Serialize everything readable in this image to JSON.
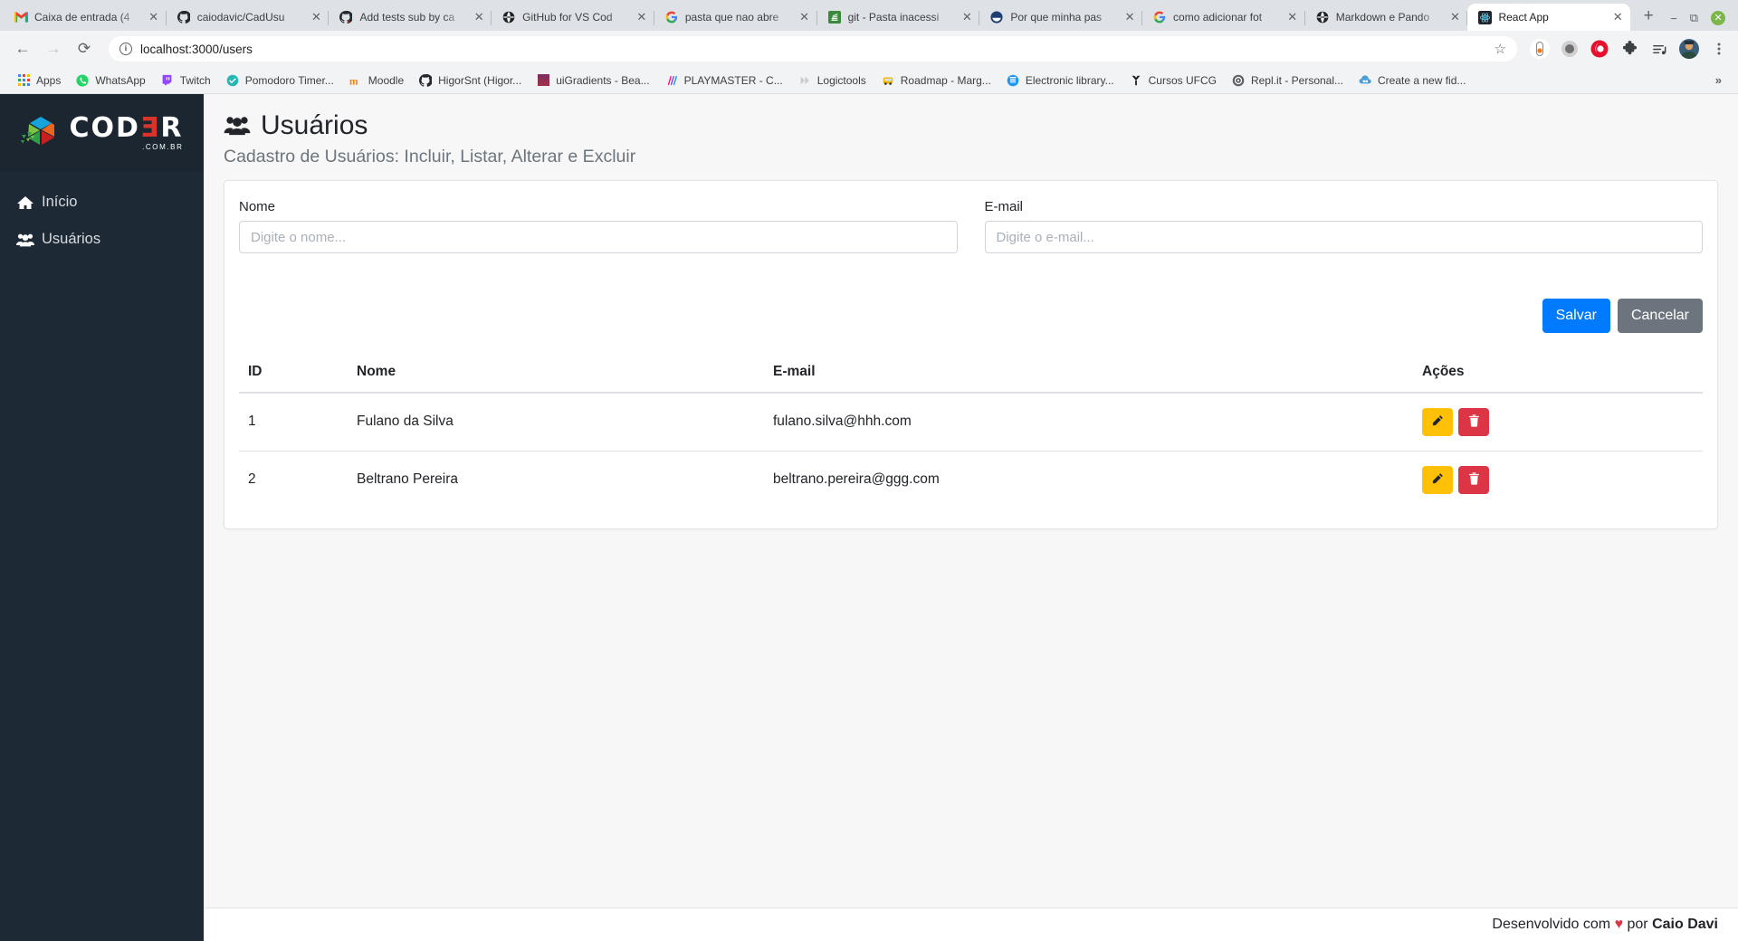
{
  "browser": {
    "tabs": [
      {
        "title": "Caixa de entrada (4",
        "favicon": "gmail-icon",
        "active": false
      },
      {
        "title": "caiodavic/CadUsu",
        "favicon": "github-icon",
        "active": false
      },
      {
        "title": "Add tests sub by ca",
        "favicon": "git-icon",
        "active": false
      },
      {
        "title": "GitHub for VS Cod",
        "favicon": "globe-icon",
        "active": false
      },
      {
        "title": "pasta que nao abre",
        "favicon": "google-icon",
        "active": false
      },
      {
        "title": "git - Pasta inacessi",
        "favicon": "stackoverflow-icon",
        "active": false
      },
      {
        "title": "Por que minha pas",
        "favicon": "blue-circle-icon",
        "active": false
      },
      {
        "title": "como adicionar fot",
        "favicon": "google-icon",
        "active": false
      },
      {
        "title": "Markdown e Pando",
        "favicon": "globe-icon",
        "active": false
      },
      {
        "title": "React App",
        "favicon": "react-icon",
        "active": true
      }
    ],
    "new_tab_label": "+",
    "window_controls": {
      "minimize": "−",
      "maximize": "⧉",
      "close": "✕"
    },
    "toolbar": {
      "back": "←",
      "forward": "→",
      "reload": "⟳",
      "site_info": "i",
      "url": "localhost:3000/users",
      "bookmark_star": "☆",
      "extensions": [
        "pill-extension-icon",
        "gray-dot-icon",
        "opera-gx-icon",
        "puzzle-extension-icon",
        "playlist-icon",
        "profile-avatar-icon",
        "kebab-menu-icon"
      ]
    },
    "bookmarks": {
      "apps_label": "Apps",
      "items": [
        {
          "label": "WhatsApp",
          "icon": "whatsapp-icon"
        },
        {
          "label": "Twitch",
          "icon": "twitch-icon"
        },
        {
          "label": "Pomodoro Timer...",
          "icon": "pomodoro-icon"
        },
        {
          "label": "Moodle",
          "icon": "moodle-icon"
        },
        {
          "label": "HigorSnt (Higor...",
          "icon": "github-icon"
        },
        {
          "label": "uiGradients - Bea...",
          "icon": "uigradients-icon"
        },
        {
          "label": "PLAYMASTER - C...",
          "icon": "playmaster-icon"
        },
        {
          "label": "Logictools",
          "icon": "logictools-icon"
        },
        {
          "label": "Roadmap - Marg...",
          "icon": "roadmap-icon"
        },
        {
          "label": "Electronic library...",
          "icon": "library-icon"
        },
        {
          "label": "Cursos UFCG",
          "icon": "ufcg-icon"
        },
        {
          "label": "Repl.it - Personal...",
          "icon": "replit-icon"
        },
        {
          "label": "Create a new fid...",
          "icon": "fiddle-icon"
        }
      ],
      "overflow": "»"
    }
  },
  "sidebar": {
    "brand": {
      "name_main": "COD",
      "name_accent": "Ǝ",
      "name_tail": "R",
      "domain": ".COM.BR"
    },
    "items": [
      {
        "label": "Início",
        "icon": "home-icon"
      },
      {
        "label": "Usuários",
        "icon": "users-icon"
      }
    ]
  },
  "page": {
    "title": "Usuários",
    "title_icon": "users-icon",
    "subtitle": "Cadastro de Usuários: Incluir, Listar, Alterar e Excluir"
  },
  "form": {
    "nome": {
      "label": "Nome",
      "value": "",
      "placeholder": "Digite o nome..."
    },
    "email": {
      "label": "E-mail",
      "value": "",
      "placeholder": "Digite o e-mail..."
    },
    "save_label": "Salvar",
    "cancel_label": "Cancelar"
  },
  "table": {
    "columns": [
      "ID",
      "Nome",
      "E-mail",
      "Ações"
    ],
    "rows": [
      {
        "id": "1",
        "nome": "Fulano da Silva",
        "email": "fulano.silva@hhh.com"
      },
      {
        "id": "2",
        "nome": "Beltrano Pereira",
        "email": "beltrano.pereira@ggg.com"
      }
    ],
    "edit_icon": "pencil-icon",
    "delete_icon": "trash-icon"
  },
  "footer": {
    "prefix": "Desenvolvido com ",
    "heart": "♥",
    "middle": " por ",
    "author": "Caio Davi"
  },
  "colors": {
    "sidebar_bg": "#1d2935",
    "primary": "#007bff",
    "secondary": "#6c757d",
    "warning": "#ffc107",
    "danger": "#dc3545",
    "brand_red": "#d9342b"
  }
}
